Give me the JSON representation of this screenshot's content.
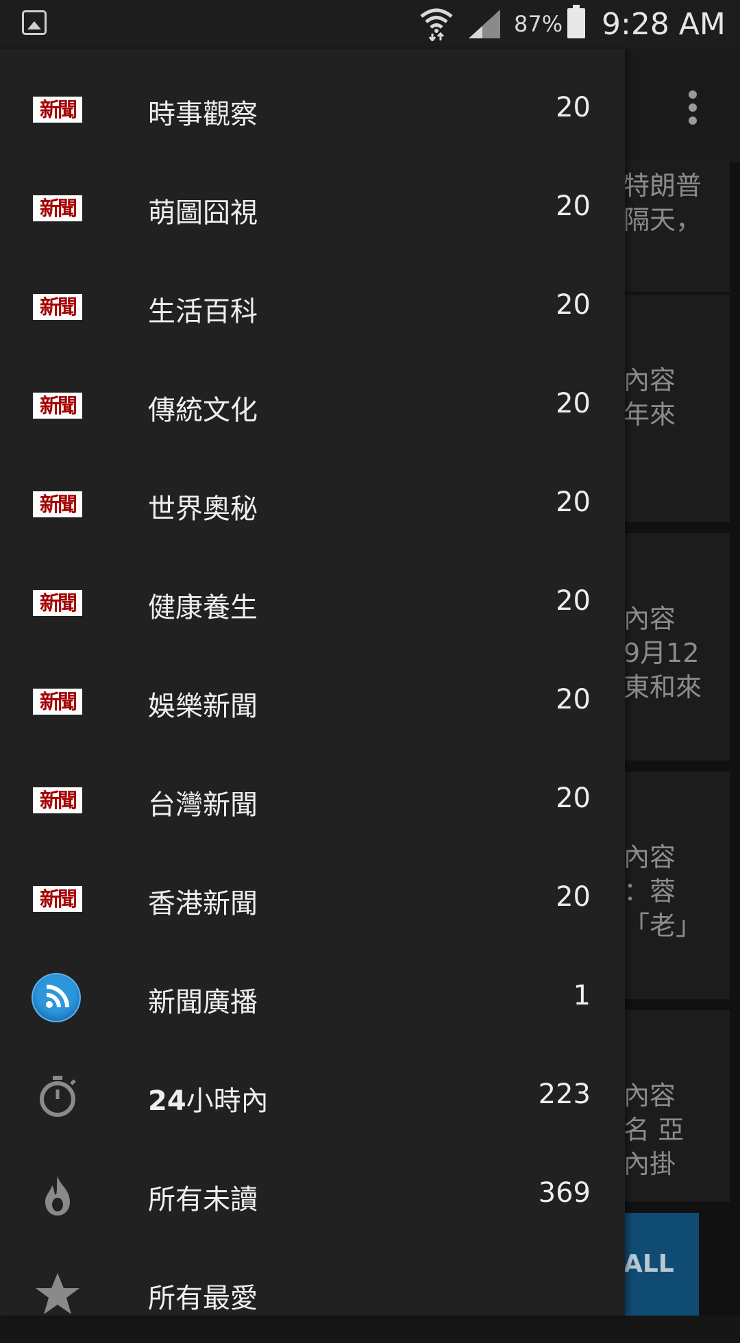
{
  "status_bar": {
    "gallery_icon": "gallery-icon",
    "wifi_icon": "wifi-icon",
    "signal_icon": "signal-icon",
    "battery_percent": "87%",
    "battery_icon": "battery-icon",
    "time": "9:28 AM"
  },
  "background_page": {
    "menu_icon": "more-vert-icon",
    "cards": [
      {
        "lines": [
          "特朗普",
          "隔天，"
        ]
      },
      {
        "lines": [
          "內容",
          "年來"
        ]
      },
      {
        "lines": [
          "內容",
          "9月12",
          "東和來"
        ]
      },
      {
        "lines": [
          "內容",
          "：蓉",
          "「老」"
        ]
      },
      {
        "lines": [
          "內容",
          "名 亞",
          "內掛"
        ]
      }
    ],
    "mark_all_label": "ALL"
  },
  "drawer": {
    "items": [
      {
        "icon": "news-icon",
        "icon_text": "新聞",
        "label": "時事觀察",
        "count": "20"
      },
      {
        "icon": "news-icon",
        "icon_text": "新聞",
        "label": "萌圖囧視",
        "count": "20"
      },
      {
        "icon": "news-icon",
        "icon_text": "新聞",
        "label": "生活百科",
        "count": "20"
      },
      {
        "icon": "news-icon",
        "icon_text": "新聞",
        "label": "傳統文化",
        "count": "20"
      },
      {
        "icon": "news-icon",
        "icon_text": "新聞",
        "label": "世界奧秘",
        "count": "20"
      },
      {
        "icon": "news-icon",
        "icon_text": "新聞",
        "label": "健康養生",
        "count": "20"
      },
      {
        "icon": "news-icon",
        "icon_text": "新聞",
        "label": "娛樂新聞",
        "count": "20"
      },
      {
        "icon": "news-icon",
        "icon_text": "新聞",
        "label": "台灣新聞",
        "count": "20"
      },
      {
        "icon": "news-icon",
        "icon_text": "新聞",
        "label": "香港新聞",
        "count": "20"
      },
      {
        "icon": "rss-icon",
        "label": "新聞廣播",
        "count": "1"
      },
      {
        "icon": "timer-icon",
        "label_bold": "24",
        "label": "小時內",
        "count": "223"
      },
      {
        "icon": "flame-icon",
        "label": "所有未讀",
        "count": "369"
      },
      {
        "icon": "star-icon",
        "label": "所有最愛",
        "count": ""
      }
    ]
  },
  "colors": {
    "drawer_bg": "#212121",
    "news_icon_red": "#a50000",
    "rss_blue": "#2e97dc",
    "mark_all_bg": "#0f4b73"
  }
}
